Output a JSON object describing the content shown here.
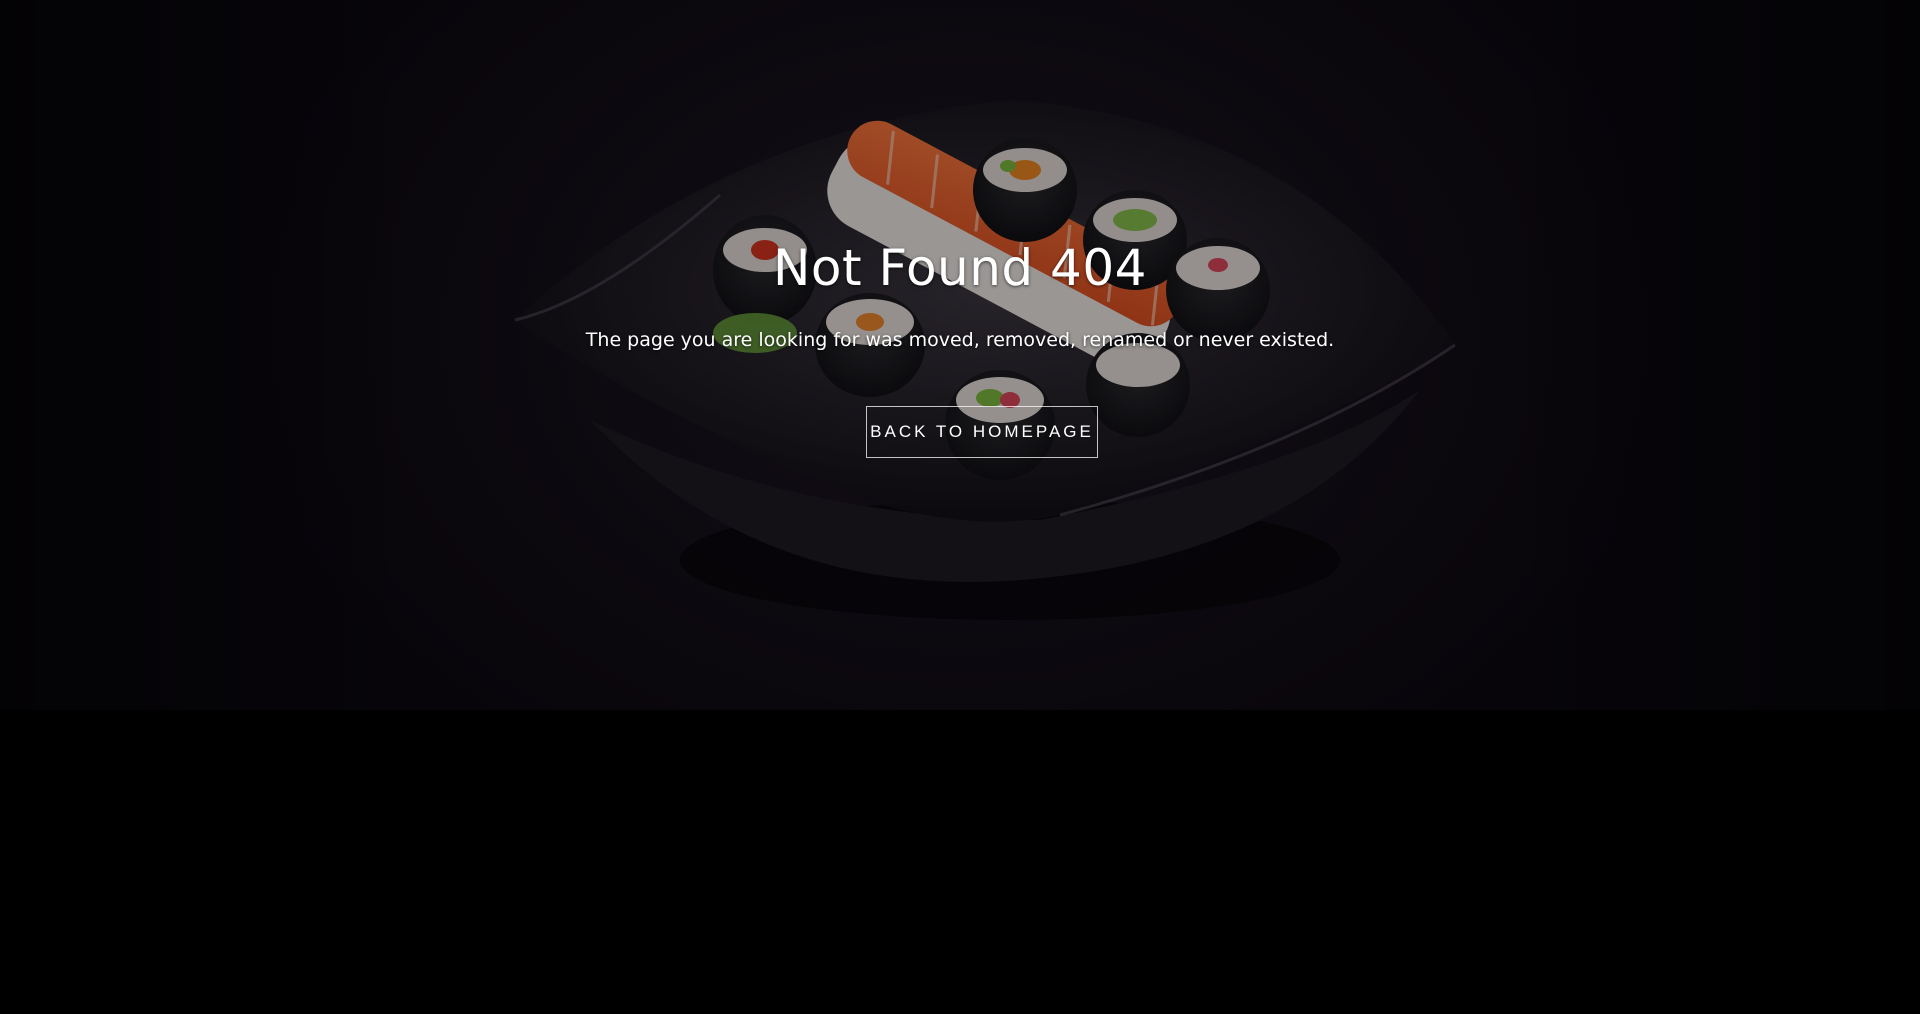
{
  "page": {
    "title": "Not Found 404",
    "message": "The page you are looking for was moved, removed, renamed or never existed.",
    "button_label": "BACK TO HOMEPAGE"
  },
  "hero": {
    "image": "sushi-plate-image",
    "background_color": "#0c090f",
    "page_background": "#000000"
  }
}
